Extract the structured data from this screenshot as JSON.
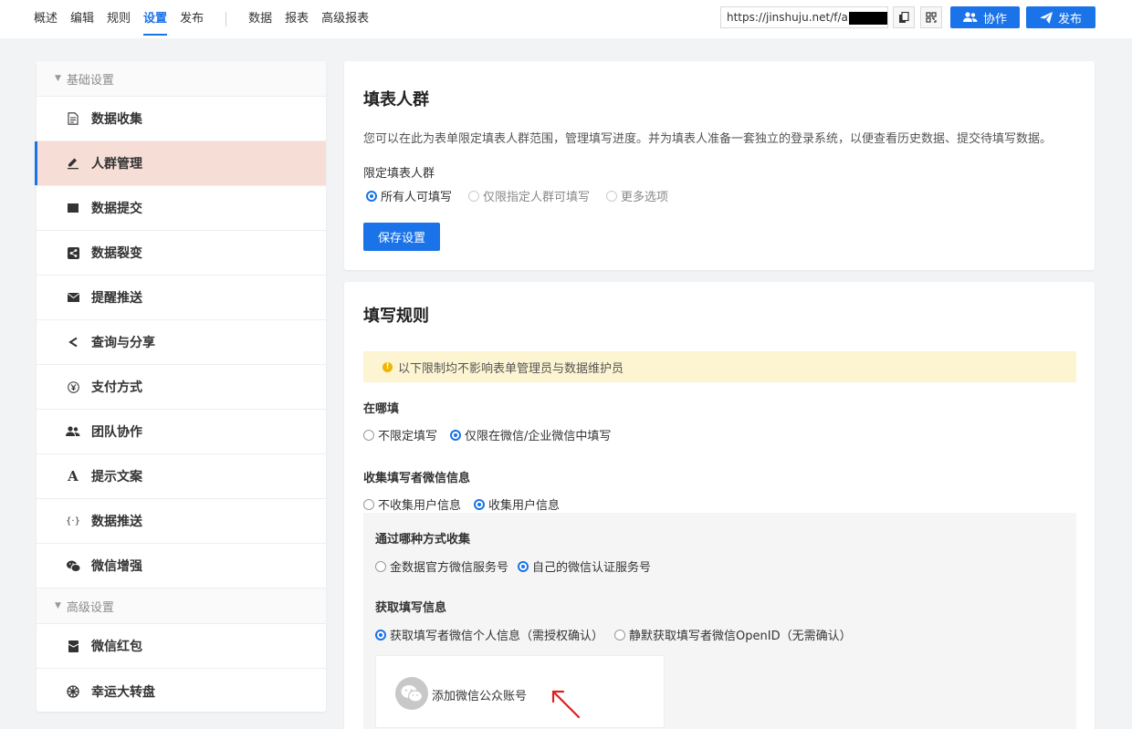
{
  "nav": {
    "items": [
      "概述",
      "编辑",
      "规则",
      "设置",
      "发布"
    ],
    "items2": [
      "数据",
      "报表",
      "高级报表"
    ],
    "active": "设置"
  },
  "header": {
    "url": "https://jinshuju.net/f/a",
    "collab_label": "协作",
    "publish_label": "发布"
  },
  "sidebar": {
    "group1": "基础设置",
    "items1": [
      {
        "label": "数据收集",
        "icon": "document-icon"
      },
      {
        "label": "人群管理",
        "icon": "pen-icon"
      },
      {
        "label": "数据提交",
        "icon": "square-icon"
      },
      {
        "label": "数据裂变",
        "icon": "fission-icon"
      },
      {
        "label": "提醒推送",
        "icon": "envelope-icon"
      },
      {
        "label": "查询与分享",
        "icon": "share-icon"
      },
      {
        "label": "支付方式",
        "icon": "yen-icon"
      },
      {
        "label": "团队协作",
        "icon": "team-icon"
      },
      {
        "label": "提示文案",
        "icon": "text-icon"
      },
      {
        "label": "数据推送",
        "icon": "braces-icon"
      },
      {
        "label": "微信增强",
        "icon": "wechat-icon"
      }
    ],
    "group2": "高级设置",
    "items2": [
      {
        "label": "微信红包",
        "icon": "redpacket-icon"
      },
      {
        "label": "幸运大转盘",
        "icon": "wheel-icon"
      }
    ],
    "active": "人群管理"
  },
  "card1": {
    "title": "填表人群",
    "desc": "您可以在此为表单限定填表人群范围，管理填写进度。并为填表人准备一套独立的登录系统，以便查看历史数据、提交待填写数据。",
    "restrict_label": "限定填表人群",
    "options": [
      "所有人可填写",
      "仅限指定人群可填写",
      "更多选项"
    ],
    "selected": "所有人可填写",
    "save_label": "保存设置"
  },
  "card2": {
    "title": "填写规则",
    "notice": "以下限制均不影响表单管理员与数据维护员",
    "where_label": "在哪填",
    "where_options": [
      "不限定填写",
      "仅限在微信/企业微信中填写"
    ],
    "where_selected": "仅限在微信/企业微信中填写",
    "collect_label": "收集填写者微信信息",
    "collect_options": [
      "不收集用户信息",
      "收集用户信息"
    ],
    "collect_selected": "收集用户信息",
    "method_label": "通过哪种方式收集",
    "method_options": [
      "金数据官方微信服务号",
      "自己的微信认证服务号"
    ],
    "method_selected": "自己的微信认证服务号",
    "fetch_label": "获取填写信息",
    "fetch_options": [
      "获取填写者微信个人信息（需授权确认）",
      "静默获取填写者微信OpenID（无需确认）"
    ],
    "fetch_selected": "获取填写者微信个人信息（需授权确认）",
    "add_account_label": "添加微信公众账号"
  },
  "colors": {
    "accent": "#1a73e8",
    "active_bg": "#f6ddd6",
    "notice_bg": "#fdf5d2",
    "arrow": "#e02020"
  }
}
